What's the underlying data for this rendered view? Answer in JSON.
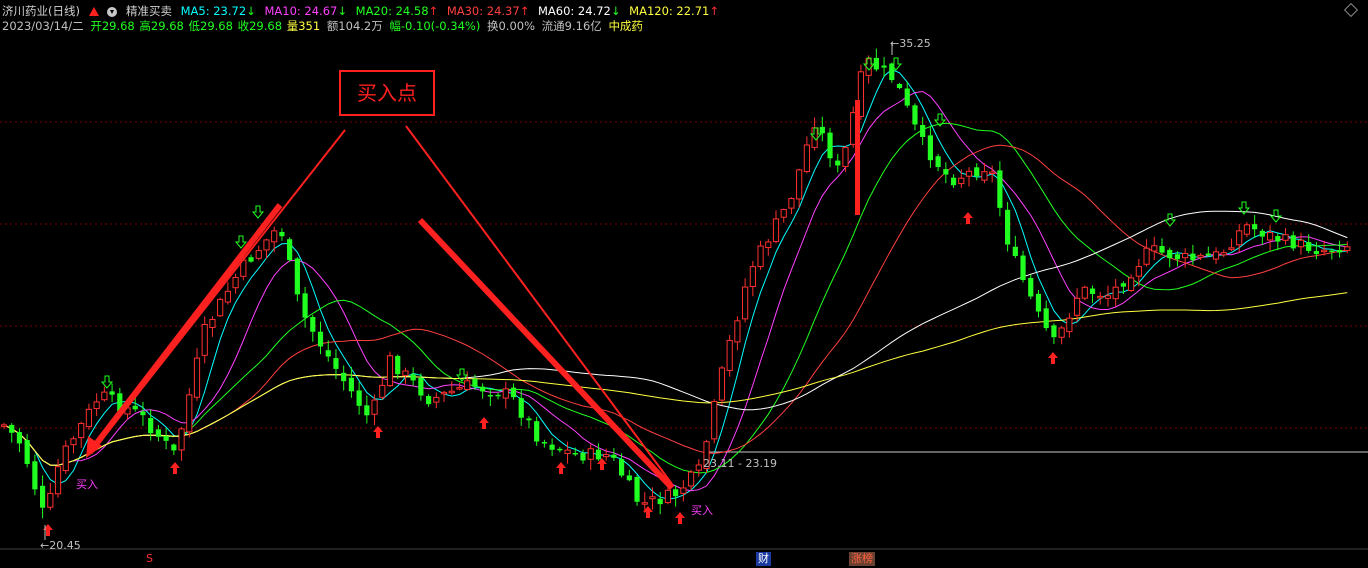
{
  "header": {
    "stock_name": "济川药业(日线)",
    "indicator_name": "精准买卖",
    "ma5": {
      "label": "MA5: 23.72",
      "arrow": "↓",
      "color": "#00ffff"
    },
    "ma10": {
      "label": "MA10: 24.67",
      "arrow": "↓",
      "color": "#ff40ff"
    },
    "ma20": {
      "label": "MA20: 24.58",
      "arrow": "↑",
      "color": "#20ff20"
    },
    "ma30": {
      "label": "MA30: 24.37",
      "arrow": "↑",
      "color": "#ff4040"
    },
    "ma60": {
      "label": "MA60: 24.72",
      "arrow": "↓",
      "color": "#ffffff"
    },
    "ma120": {
      "label": "MA120: 22.71",
      "arrow": "↑",
      "color": "#ffff40"
    }
  },
  "info_row": {
    "date": "2023/03/14/二",
    "open": "开29.68",
    "high": "高29.68",
    "low": "低29.68",
    "close": "收29.68",
    "volume": "量351",
    "amount": "额104.2万",
    "change": "幅-0.10(-0.34%)",
    "turnover": "换0.00%",
    "float": "流通9.16亿",
    "concept": "中成药"
  },
  "annotation": {
    "box_text": "买入点",
    "buy_label_1": "买入",
    "buy_label_2": "买入"
  },
  "chart_labels": {
    "low_extreme": "20.45",
    "high_extreme": "35.25",
    "cursor_range": "23.11 - 23.19"
  },
  "bottom_markers": {
    "s_marker": "S",
    "finance": "财",
    "limit_list": "涨榜"
  },
  "colors": {
    "up": "#ff3030",
    "down": "#20ff20",
    "grid": "#7a0000",
    "annotation": "#ff2020",
    "buy_arrow": "#ff2020",
    "sell_arrow": "#20ff20"
  },
  "chart_data": {
    "type": "candlestick",
    "price_range": [
      19.8,
      36.2
    ],
    "series_count": 175
  }
}
